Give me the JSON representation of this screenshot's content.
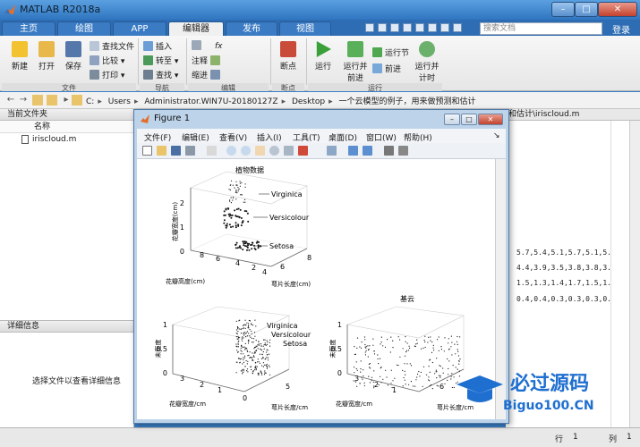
{
  "window": {
    "title": "MATLAB R2018a",
    "min": "–",
    "max": "□",
    "close": "✕"
  },
  "tabs": [
    {
      "label": "主页"
    },
    {
      "label": "绘图"
    },
    {
      "label": "APP"
    },
    {
      "label": "编辑器"
    },
    {
      "label": "发布"
    },
    {
      "label": "视图"
    }
  ],
  "active_tab": "编辑器",
  "search": {
    "placeholder": "搜索文档"
  },
  "login": "登录",
  "ribbon": {
    "file": {
      "new": "新建",
      "open": "打开",
      "save": "保存",
      "find_files": "查找文件",
      "compare": "比较",
      "print": "打印",
      "group": "文件"
    },
    "nav": {
      "insert": "插入",
      "goto": "转至",
      "find": "查找",
      "group": "导航"
    },
    "edit": {
      "comment": "注释",
      "indent": "缩进",
      "group": "编辑"
    },
    "breakpoints": {
      "label": "断点",
      "group": "断点"
    },
    "run": {
      "run": "运行",
      "run_advance": "运行并前进",
      "run_section": "运行节",
      "advance": "前进",
      "run_time": "运行并计时",
      "group": "运行"
    }
  },
  "address": {
    "crumbs": [
      "C:",
      "Users",
      "Administrator.WIN7U-20180127Z",
      "Desktop",
      "一个云模型的例子，用来做预测和估计"
    ]
  },
  "current_folder": {
    "title": "当前文件夹",
    "col_name": "名称",
    "files": [
      "iriscloud.m"
    ]
  },
  "details": {
    "title": "详细信息",
    "message": "选择文件以查看详细信息"
  },
  "editor": {
    "tab": "和估计\\iriscloud.m",
    "lines": [
      "5.7,5.4,5.1,5.7,5.1,5.",
      "4.4,3.9,3.5,3.8,3.8,3.",
      "1.5,1.3,1.4,1.7,1.5,1.",
      "0.4,0.4,0.3,0.3,0.3,0."
    ]
  },
  "status": {
    "row_label": "行",
    "row": "1",
    "col_label": "列",
    "col": "1"
  },
  "figure": {
    "title": "Figure 1",
    "menu": [
      "文件(F)",
      "编辑(E)",
      "查看(V)",
      "插入(I)",
      "工具(T)",
      "桌面(D)",
      "窗口(W)",
      "帮助(H)"
    ],
    "plot1": {
      "title": "植物数据",
      "zlabel": "花瓣宽度(cm)",
      "xlabel": "萼片长度(cm)",
      "ylabel": "花瓣高度(cm)",
      "zticks": [
        "0",
        "1",
        "2"
      ],
      "xticks": [
        "4",
        "6",
        "8"
      ],
      "yticks": [
        "2",
        "4",
        "6",
        "8"
      ],
      "labels": [
        "Virginica",
        "Versicolour",
        "Setosa"
      ]
    },
    "plot2": {
      "zlabel": "未医度",
      "xlabel": "萼片长度/cm",
      "ylabel": "花瓣宽度/cm",
      "zticks": [
        "0",
        "0.5",
        "1"
      ],
      "xticks": [
        "0",
        "5"
      ],
      "yticks": [
        "0",
        "1",
        "2",
        "3"
      ],
      "labels": [
        "Virginica",
        "Versicolour",
        "Setosa"
      ]
    },
    "plot3": {
      "title": "基云",
      "zlabel": "未医度",
      "xlabel": "萼片长度/cm",
      "ylabel": "花瓣宽度/cm",
      "zticks": [
        "0",
        "0.5",
        "1"
      ],
      "xticks": [
        "6"
      ],
      "yticks": [
        "0",
        "1",
        "2",
        "3"
      ]
    }
  },
  "watermark": {
    "text": "必过源码",
    "domain": "Biguo100.CN"
  },
  "colors": {
    "accent": "#2e6cb3",
    "point": "#111111",
    "watermark_blue": "#1f6fd0",
    "watermark_red": "#e02020"
  }
}
